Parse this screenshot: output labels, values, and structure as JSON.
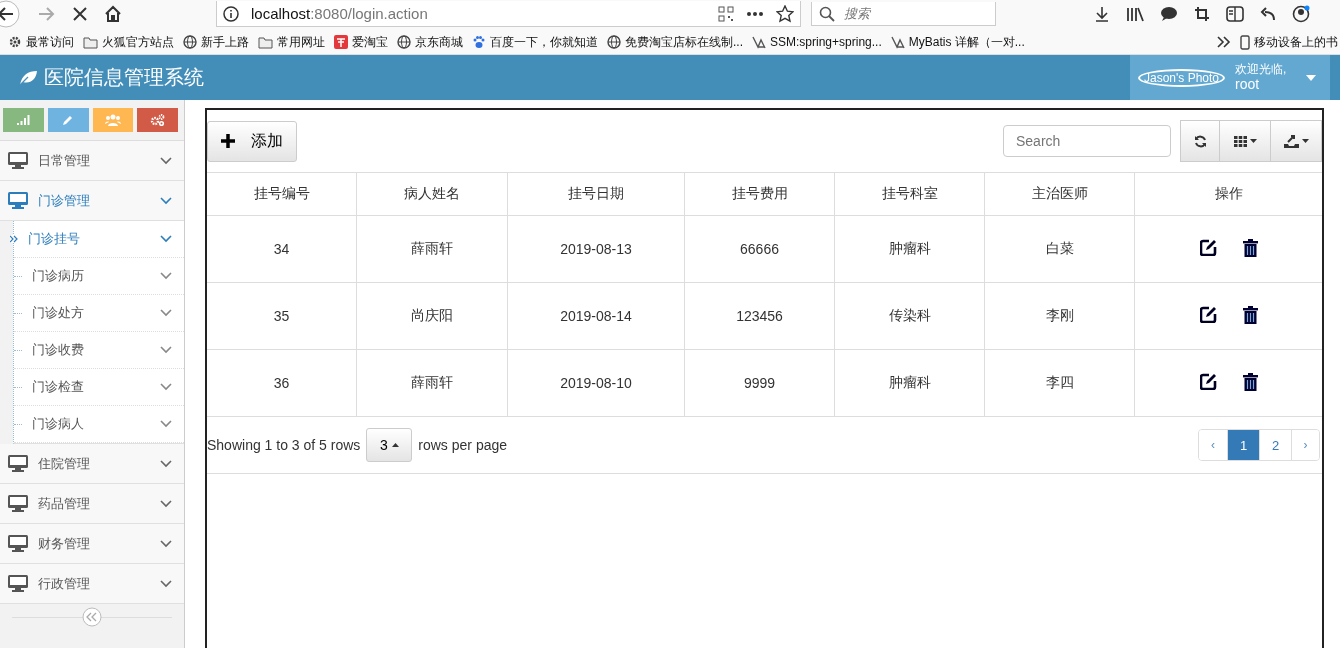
{
  "browser": {
    "url_host": "localhost",
    "url_rest": ":8080/login.action",
    "search_placeholder": "搜索",
    "bookmarks": [
      {
        "kind": "gear",
        "label": "最常访问"
      },
      {
        "kind": "folder",
        "label": "火狐官方站点"
      },
      {
        "kind": "globe",
        "label": "新手上路"
      },
      {
        "kind": "folder",
        "label": "常用网址"
      },
      {
        "kind": "taobao",
        "label": "爱淘宝"
      },
      {
        "kind": "globe",
        "label": "京东商城"
      },
      {
        "kind": "paw",
        "label": "百度一下，你就知道"
      },
      {
        "kind": "globe",
        "label": "免费淘宝店标在线制..."
      },
      {
        "kind": "bird",
        "label": "SSM:spring+spring..."
      },
      {
        "kind": "bird",
        "label": "MyBatis 详解（一对..."
      }
    ],
    "mobile_bookmarks": "移动设备上的书"
  },
  "app": {
    "title": "医院信息管理系统",
    "user": {
      "photo_alt": "Jason's Photo",
      "greeting": "欢迎光临,",
      "name": "root"
    }
  },
  "sidebar": {
    "shortcuts": [
      {
        "kind": "signal",
        "color": "#87b87f"
      },
      {
        "kind": "pencil",
        "color": "#6fb3e0"
      },
      {
        "kind": "users",
        "color": "#ffb752"
      },
      {
        "kind": "cogs",
        "color": "#d15b47"
      }
    ],
    "menu": [
      {
        "label": "日常管理",
        "expanded": false
      },
      {
        "label": "门诊管理",
        "expanded": true,
        "children": [
          {
            "label": "门诊挂号",
            "selected": true
          },
          {
            "label": "门诊病历",
            "selected": false
          },
          {
            "label": "门诊处方",
            "selected": false
          },
          {
            "label": "门诊收费",
            "selected": false
          },
          {
            "label": "门诊检查",
            "selected": false
          },
          {
            "label": "门诊病人",
            "selected": false
          }
        ]
      },
      {
        "label": "住院管理",
        "expanded": false
      },
      {
        "label": "药品管理",
        "expanded": false
      },
      {
        "label": "财务管理",
        "expanded": false
      },
      {
        "label": "行政管理",
        "expanded": false
      }
    ]
  },
  "toolbar": {
    "add_button": "添加",
    "search_placeholder": "Search"
  },
  "table": {
    "columns": [
      "挂号编号",
      "病人姓名",
      "挂号日期",
      "挂号费用",
      "挂号科室",
      "主治医师",
      "操作"
    ],
    "rows": [
      [
        "34",
        "薛雨轩",
        "2019-08-13",
        "66666",
        "肿瘤科",
        "白菜"
      ],
      [
        "35",
        "尚庆阳",
        "2019-08-14",
        "123456",
        "传染科",
        "李刚"
      ],
      [
        "36",
        "薛雨轩",
        "2019-08-10",
        "9999",
        "肿瘤科",
        "李四"
      ]
    ]
  },
  "pagination": {
    "summary": "Showing 1 to 3 of 5 rows",
    "page_size": "3",
    "page_size_suffix": "rows per page",
    "prev": "‹",
    "next": "›",
    "pages": [
      {
        "label": "1",
        "selected": true
      },
      {
        "label": "2",
        "selected": false
      }
    ]
  }
}
